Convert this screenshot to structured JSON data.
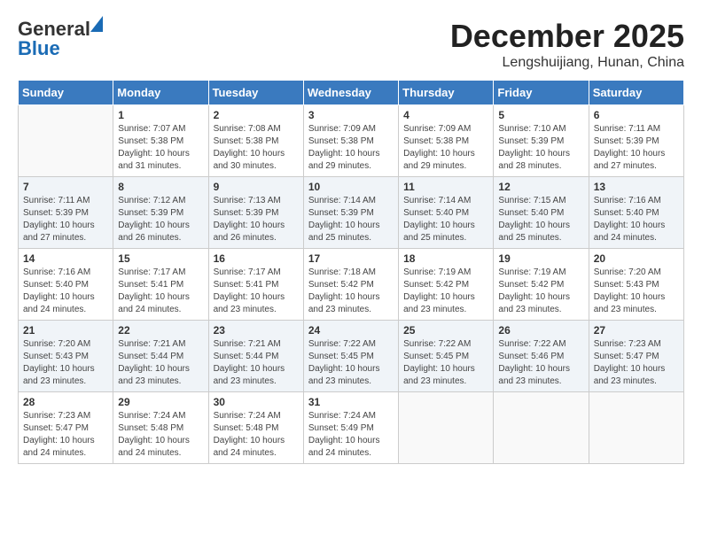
{
  "logo": {
    "general": "General",
    "blue": "Blue"
  },
  "header": {
    "month": "December 2025",
    "location": "Lengshuijiang, Hunan, China"
  },
  "days_of_week": [
    "Sunday",
    "Monday",
    "Tuesday",
    "Wednesday",
    "Thursday",
    "Friday",
    "Saturday"
  ],
  "weeks": [
    [
      {
        "day": "",
        "info": ""
      },
      {
        "day": "1",
        "info": "Sunrise: 7:07 AM\nSunset: 5:38 PM\nDaylight: 10 hours\nand 31 minutes."
      },
      {
        "day": "2",
        "info": "Sunrise: 7:08 AM\nSunset: 5:38 PM\nDaylight: 10 hours\nand 30 minutes."
      },
      {
        "day": "3",
        "info": "Sunrise: 7:09 AM\nSunset: 5:38 PM\nDaylight: 10 hours\nand 29 minutes."
      },
      {
        "day": "4",
        "info": "Sunrise: 7:09 AM\nSunset: 5:38 PM\nDaylight: 10 hours\nand 29 minutes."
      },
      {
        "day": "5",
        "info": "Sunrise: 7:10 AM\nSunset: 5:39 PM\nDaylight: 10 hours\nand 28 minutes."
      },
      {
        "day": "6",
        "info": "Sunrise: 7:11 AM\nSunset: 5:39 PM\nDaylight: 10 hours\nand 27 minutes."
      }
    ],
    [
      {
        "day": "7",
        "info": "Sunrise: 7:11 AM\nSunset: 5:39 PM\nDaylight: 10 hours\nand 27 minutes."
      },
      {
        "day": "8",
        "info": "Sunrise: 7:12 AM\nSunset: 5:39 PM\nDaylight: 10 hours\nand 26 minutes."
      },
      {
        "day": "9",
        "info": "Sunrise: 7:13 AM\nSunset: 5:39 PM\nDaylight: 10 hours\nand 26 minutes."
      },
      {
        "day": "10",
        "info": "Sunrise: 7:14 AM\nSunset: 5:39 PM\nDaylight: 10 hours\nand 25 minutes."
      },
      {
        "day": "11",
        "info": "Sunrise: 7:14 AM\nSunset: 5:40 PM\nDaylight: 10 hours\nand 25 minutes."
      },
      {
        "day": "12",
        "info": "Sunrise: 7:15 AM\nSunset: 5:40 PM\nDaylight: 10 hours\nand 25 minutes."
      },
      {
        "day": "13",
        "info": "Sunrise: 7:16 AM\nSunset: 5:40 PM\nDaylight: 10 hours\nand 24 minutes."
      }
    ],
    [
      {
        "day": "14",
        "info": "Sunrise: 7:16 AM\nSunset: 5:40 PM\nDaylight: 10 hours\nand 24 minutes."
      },
      {
        "day": "15",
        "info": "Sunrise: 7:17 AM\nSunset: 5:41 PM\nDaylight: 10 hours\nand 24 minutes."
      },
      {
        "day": "16",
        "info": "Sunrise: 7:17 AM\nSunset: 5:41 PM\nDaylight: 10 hours\nand 23 minutes."
      },
      {
        "day": "17",
        "info": "Sunrise: 7:18 AM\nSunset: 5:42 PM\nDaylight: 10 hours\nand 23 minutes."
      },
      {
        "day": "18",
        "info": "Sunrise: 7:19 AM\nSunset: 5:42 PM\nDaylight: 10 hours\nand 23 minutes."
      },
      {
        "day": "19",
        "info": "Sunrise: 7:19 AM\nSunset: 5:42 PM\nDaylight: 10 hours\nand 23 minutes."
      },
      {
        "day": "20",
        "info": "Sunrise: 7:20 AM\nSunset: 5:43 PM\nDaylight: 10 hours\nand 23 minutes."
      }
    ],
    [
      {
        "day": "21",
        "info": "Sunrise: 7:20 AM\nSunset: 5:43 PM\nDaylight: 10 hours\nand 23 minutes."
      },
      {
        "day": "22",
        "info": "Sunrise: 7:21 AM\nSunset: 5:44 PM\nDaylight: 10 hours\nand 23 minutes."
      },
      {
        "day": "23",
        "info": "Sunrise: 7:21 AM\nSunset: 5:44 PM\nDaylight: 10 hours\nand 23 minutes."
      },
      {
        "day": "24",
        "info": "Sunrise: 7:22 AM\nSunset: 5:45 PM\nDaylight: 10 hours\nand 23 minutes."
      },
      {
        "day": "25",
        "info": "Sunrise: 7:22 AM\nSunset: 5:45 PM\nDaylight: 10 hours\nand 23 minutes."
      },
      {
        "day": "26",
        "info": "Sunrise: 7:22 AM\nSunset: 5:46 PM\nDaylight: 10 hours\nand 23 minutes."
      },
      {
        "day": "27",
        "info": "Sunrise: 7:23 AM\nSunset: 5:47 PM\nDaylight: 10 hours\nand 23 minutes."
      }
    ],
    [
      {
        "day": "28",
        "info": "Sunrise: 7:23 AM\nSunset: 5:47 PM\nDaylight: 10 hours\nand 24 minutes."
      },
      {
        "day": "29",
        "info": "Sunrise: 7:24 AM\nSunset: 5:48 PM\nDaylight: 10 hours\nand 24 minutes."
      },
      {
        "day": "30",
        "info": "Sunrise: 7:24 AM\nSunset: 5:48 PM\nDaylight: 10 hours\nand 24 minutes."
      },
      {
        "day": "31",
        "info": "Sunrise: 7:24 AM\nSunset: 5:49 PM\nDaylight: 10 hours\nand 24 minutes."
      },
      {
        "day": "",
        "info": ""
      },
      {
        "day": "",
        "info": ""
      },
      {
        "day": "",
        "info": ""
      }
    ]
  ]
}
